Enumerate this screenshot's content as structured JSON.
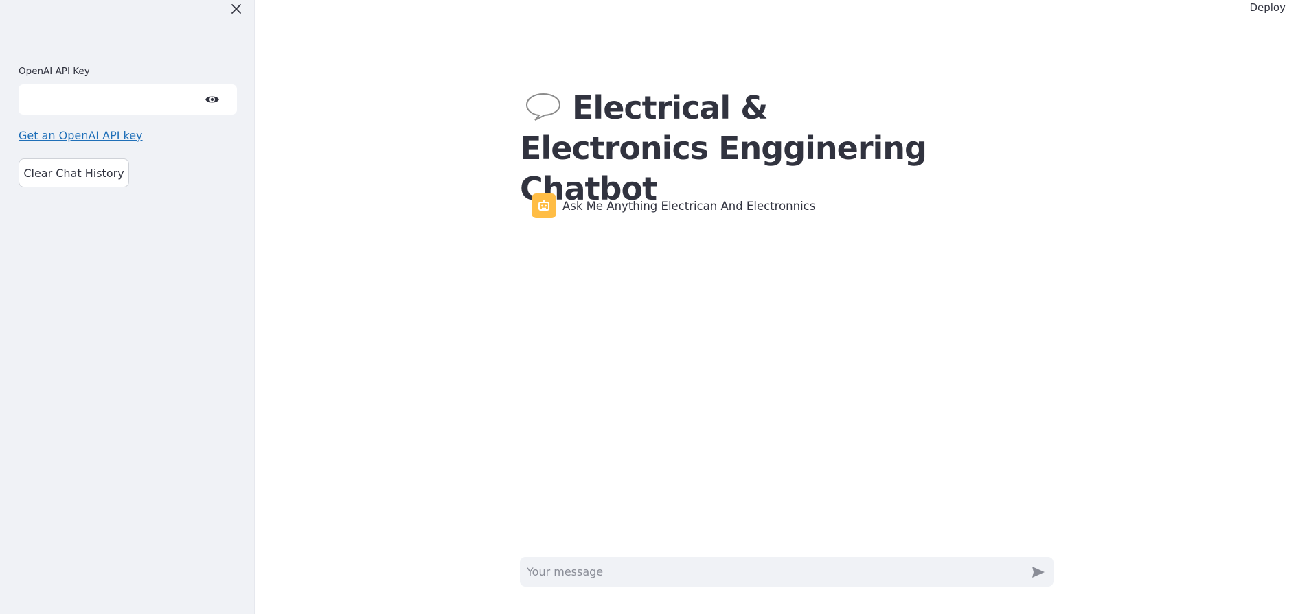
{
  "sidebar": {
    "close_icon": "close-icon",
    "api_key_label": "OpenAI API Key",
    "api_key_value": "",
    "eye_icon": "eye-icon",
    "link_text": "Get an OpenAI API key",
    "clear_button": "Clear Chat History"
  },
  "header": {
    "deploy_label": "Deploy"
  },
  "main": {
    "title": "Electrical & Electronics Engginering Chatbot",
    "title_icon": "speech-balloon-icon",
    "messages": [
      {
        "role": "assistant",
        "avatar_icon": "robot-icon",
        "text": "Ask Me Anything Electrican And Electronnics"
      }
    ],
    "chat_input": {
      "placeholder": "Your message",
      "value": ""
    },
    "send_icon": "send-icon"
  },
  "colors": {
    "sidebar_bg": "#f0f2f6",
    "text": "#31333f",
    "link": "#1f6fb8",
    "avatar_bg": "#ffbd45"
  }
}
